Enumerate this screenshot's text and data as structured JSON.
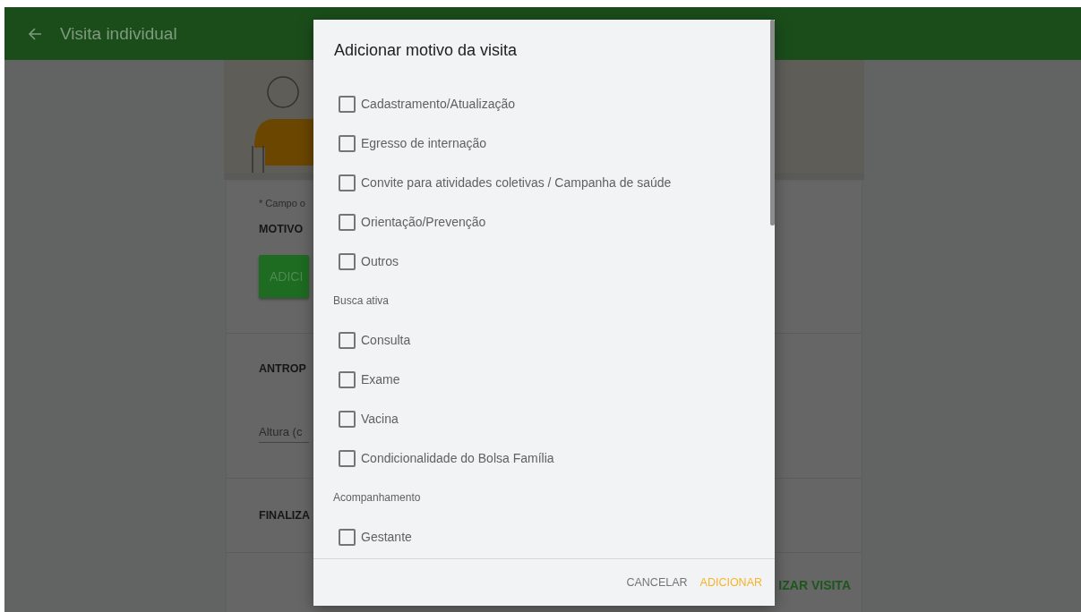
{
  "app_bar": {
    "title": "Visita individual"
  },
  "form": {
    "required_note": "* Campo o",
    "motivo_heading": "MOTIVO",
    "add_button": "ADICI",
    "antropometria_heading": "ANTROP",
    "altura_field": {
      "placeholder": "Altura (c"
    },
    "finalizar_heading": "FINALIZA",
    "finish_button": "IZAR VISITA"
  },
  "dialog": {
    "title": "Adicionar motivo da visita",
    "items": [
      {
        "kind": "checkbox",
        "label": "Cadastramento/Atualização",
        "checked": false
      },
      {
        "kind": "checkbox",
        "label": "Egresso de internação",
        "checked": false
      },
      {
        "kind": "checkbox",
        "label": "Convite para atividades coletivas / Campanha de saúde",
        "checked": false
      },
      {
        "kind": "checkbox",
        "label": "Orientação/Prevenção",
        "checked": false
      },
      {
        "kind": "checkbox",
        "label": "Outros",
        "checked": false
      },
      {
        "kind": "header",
        "label": "Busca ativa"
      },
      {
        "kind": "checkbox",
        "label": "Consulta",
        "checked": false
      },
      {
        "kind": "checkbox",
        "label": "Exame",
        "checked": false
      },
      {
        "kind": "checkbox",
        "label": "Vacina",
        "checked": false
      },
      {
        "kind": "checkbox",
        "label": "Condicionalidade do Bolsa Família",
        "checked": false
      },
      {
        "kind": "header",
        "label": "Acompanhamento"
      },
      {
        "kind": "checkbox",
        "label": "Gestante",
        "checked": false
      }
    ],
    "buttons": {
      "cancel": "CANCELAR",
      "confirm": "ADICIONAR"
    }
  }
}
